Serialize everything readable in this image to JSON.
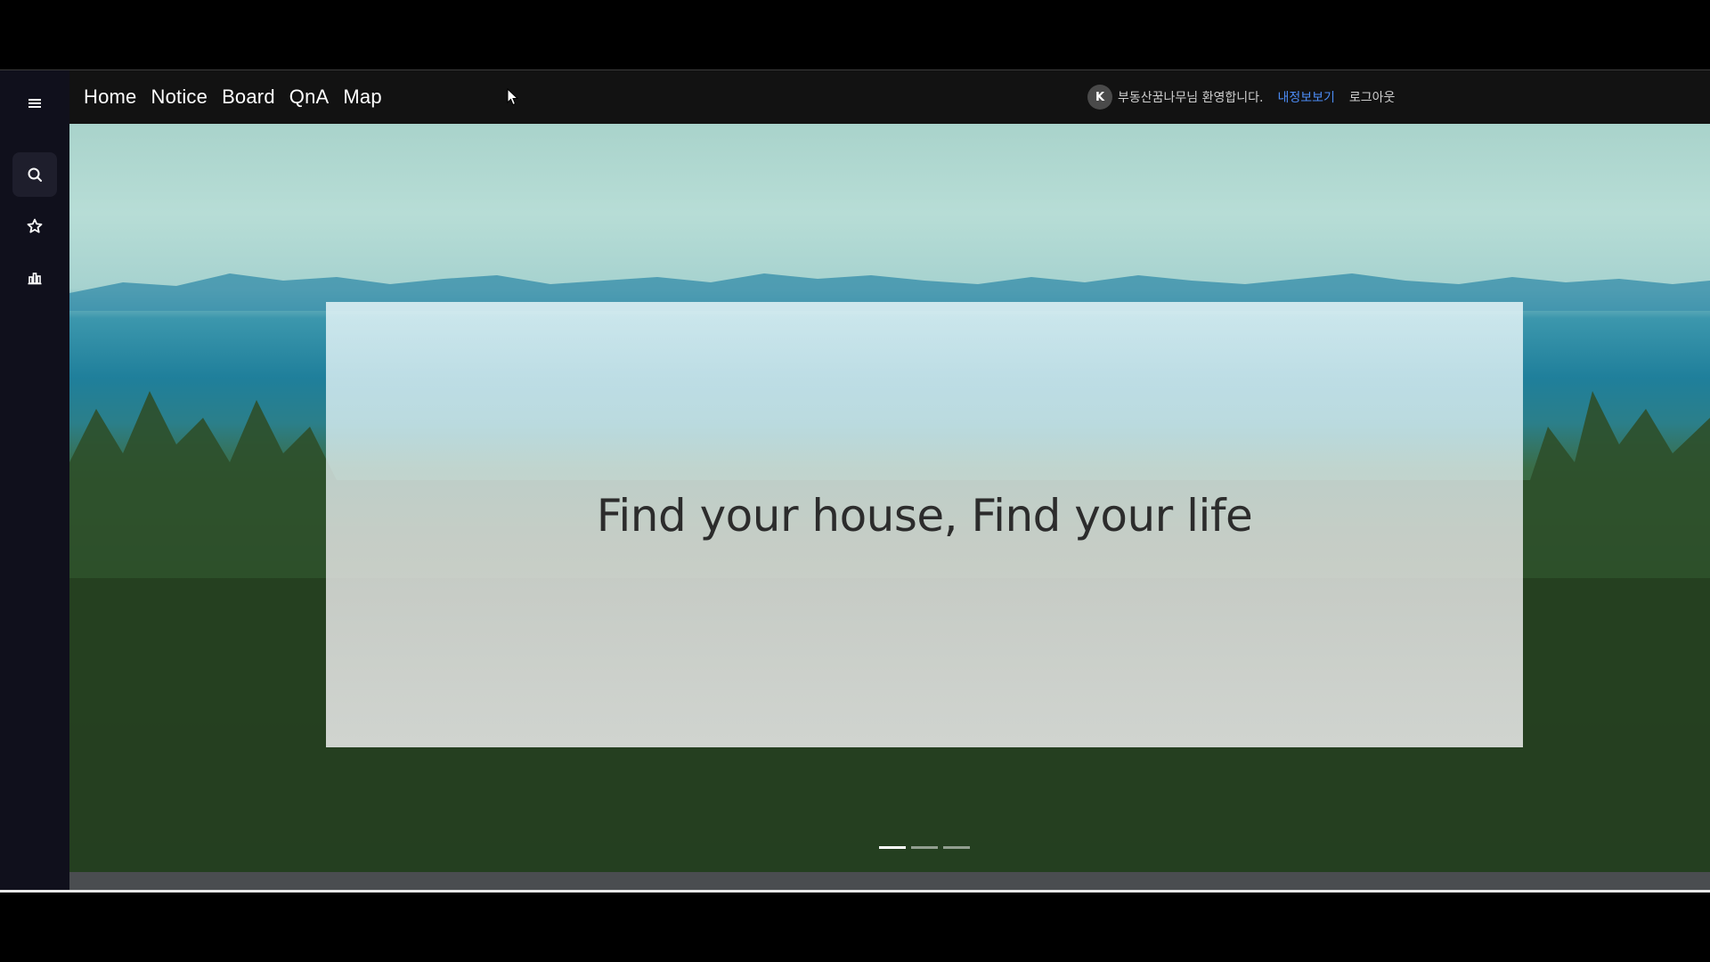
{
  "nav": {
    "items": [
      {
        "label": "Home"
      },
      {
        "label": "Notice"
      },
      {
        "label": "Board"
      },
      {
        "label": "QnA"
      },
      {
        "label": "Map"
      }
    ]
  },
  "user": {
    "avatar_initial": "K",
    "welcome": "부동산꿈나무님 환영합니다.",
    "myinfo_label": "내정보보기",
    "logout_label": "로그아웃"
  },
  "sidebar": {
    "items": [
      {
        "icon": "menu-icon"
      },
      {
        "icon": "search-icon"
      },
      {
        "icon": "star-icon"
      },
      {
        "icon": "bar-chart-icon"
      }
    ]
  },
  "hero": {
    "caption": "Find your house, Find your life",
    "slide_count": 3,
    "active_slide": 1
  },
  "colors": {
    "sidebar_bg": "#10101c",
    "topbar_bg": "#121212",
    "link_accent": "#4c8cf5"
  }
}
